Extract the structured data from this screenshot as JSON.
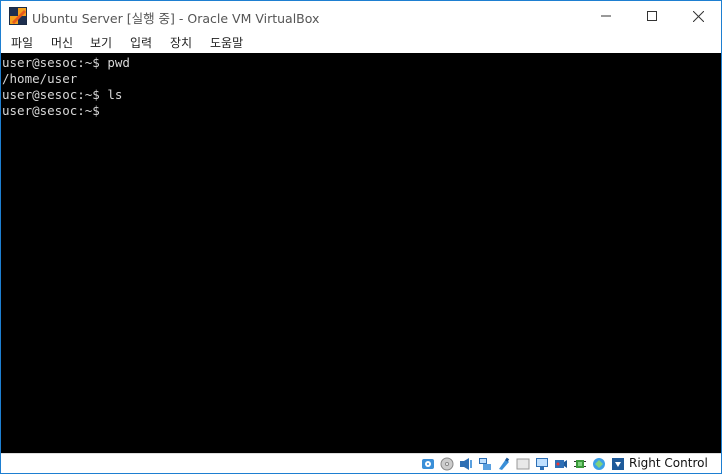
{
  "window": {
    "title": "Ubuntu Server [실행 중] - Oracle VM VirtualBox",
    "controls": [
      "minimize-icon",
      "maximize-icon",
      "close-icon"
    ]
  },
  "menu": {
    "items": [
      {
        "label": "파일"
      },
      {
        "label": "머신"
      },
      {
        "label": "보기"
      },
      {
        "label": "입력"
      },
      {
        "label": "장치"
      },
      {
        "label": "도움말"
      }
    ]
  },
  "console": {
    "lines": [
      "user@sesoc:~$ pwd",
      "/home/user",
      "user@sesoc:~$ ls",
      "user@sesoc:~$"
    ]
  },
  "statusbar": {
    "icons": [
      "hard-disk-icon",
      "optical-drive-icon",
      "audio-icon",
      "network-icon",
      "usb-icon",
      "shared-folders-icon",
      "display-icon",
      "video-capture-icon",
      "cpu-icon",
      "mouse-integration-icon",
      "keyboard-icon"
    ],
    "host_key": "Right Control"
  },
  "colors": {
    "console_bg": "#000000",
    "console_text": "#d7d7d7",
    "window_border": "#1e7fd1"
  }
}
